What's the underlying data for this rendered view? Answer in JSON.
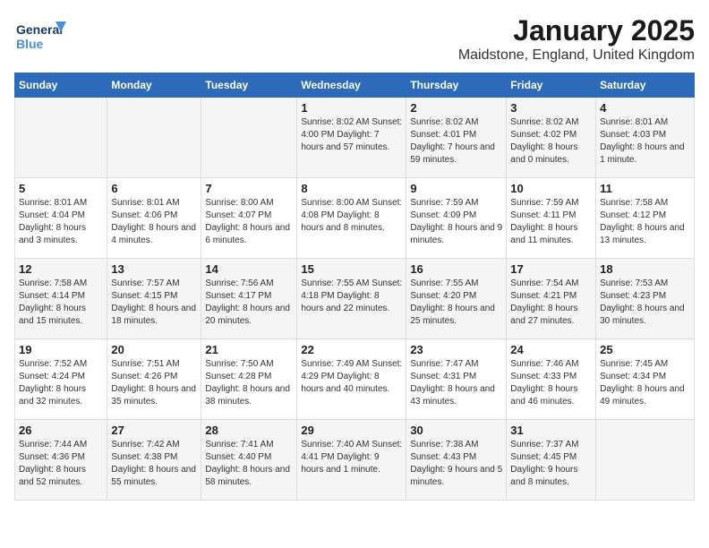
{
  "logo": {
    "line1": "General",
    "line2": "Blue"
  },
  "title": "January 2025",
  "subtitle": "Maidstone, England, United Kingdom",
  "weekdays": [
    "Sunday",
    "Monday",
    "Tuesday",
    "Wednesday",
    "Thursday",
    "Friday",
    "Saturday"
  ],
  "weeks": [
    [
      {
        "day": "",
        "content": ""
      },
      {
        "day": "",
        "content": ""
      },
      {
        "day": "",
        "content": ""
      },
      {
        "day": "1",
        "content": "Sunrise: 8:02 AM\nSunset: 4:00 PM\nDaylight: 7 hours and 57 minutes."
      },
      {
        "day": "2",
        "content": "Sunrise: 8:02 AM\nSunset: 4:01 PM\nDaylight: 7 hours and 59 minutes."
      },
      {
        "day": "3",
        "content": "Sunrise: 8:02 AM\nSunset: 4:02 PM\nDaylight: 8 hours and 0 minutes."
      },
      {
        "day": "4",
        "content": "Sunrise: 8:01 AM\nSunset: 4:03 PM\nDaylight: 8 hours and 1 minute."
      }
    ],
    [
      {
        "day": "5",
        "content": "Sunrise: 8:01 AM\nSunset: 4:04 PM\nDaylight: 8 hours and 3 minutes."
      },
      {
        "day": "6",
        "content": "Sunrise: 8:01 AM\nSunset: 4:06 PM\nDaylight: 8 hours and 4 minutes."
      },
      {
        "day": "7",
        "content": "Sunrise: 8:00 AM\nSunset: 4:07 PM\nDaylight: 8 hours and 6 minutes."
      },
      {
        "day": "8",
        "content": "Sunrise: 8:00 AM\nSunset: 4:08 PM\nDaylight: 8 hours and 8 minutes."
      },
      {
        "day": "9",
        "content": "Sunrise: 7:59 AM\nSunset: 4:09 PM\nDaylight: 8 hours and 9 minutes."
      },
      {
        "day": "10",
        "content": "Sunrise: 7:59 AM\nSunset: 4:11 PM\nDaylight: 8 hours and 11 minutes."
      },
      {
        "day": "11",
        "content": "Sunrise: 7:58 AM\nSunset: 4:12 PM\nDaylight: 8 hours and 13 minutes."
      }
    ],
    [
      {
        "day": "12",
        "content": "Sunrise: 7:58 AM\nSunset: 4:14 PM\nDaylight: 8 hours and 15 minutes."
      },
      {
        "day": "13",
        "content": "Sunrise: 7:57 AM\nSunset: 4:15 PM\nDaylight: 8 hours and 18 minutes."
      },
      {
        "day": "14",
        "content": "Sunrise: 7:56 AM\nSunset: 4:17 PM\nDaylight: 8 hours and 20 minutes."
      },
      {
        "day": "15",
        "content": "Sunrise: 7:55 AM\nSunset: 4:18 PM\nDaylight: 8 hours and 22 minutes."
      },
      {
        "day": "16",
        "content": "Sunrise: 7:55 AM\nSunset: 4:20 PM\nDaylight: 8 hours and 25 minutes."
      },
      {
        "day": "17",
        "content": "Sunrise: 7:54 AM\nSunset: 4:21 PM\nDaylight: 8 hours and 27 minutes."
      },
      {
        "day": "18",
        "content": "Sunrise: 7:53 AM\nSunset: 4:23 PM\nDaylight: 8 hours and 30 minutes."
      }
    ],
    [
      {
        "day": "19",
        "content": "Sunrise: 7:52 AM\nSunset: 4:24 PM\nDaylight: 8 hours and 32 minutes."
      },
      {
        "day": "20",
        "content": "Sunrise: 7:51 AM\nSunset: 4:26 PM\nDaylight: 8 hours and 35 minutes."
      },
      {
        "day": "21",
        "content": "Sunrise: 7:50 AM\nSunset: 4:28 PM\nDaylight: 8 hours and 38 minutes."
      },
      {
        "day": "22",
        "content": "Sunrise: 7:49 AM\nSunset: 4:29 PM\nDaylight: 8 hours and 40 minutes."
      },
      {
        "day": "23",
        "content": "Sunrise: 7:47 AM\nSunset: 4:31 PM\nDaylight: 8 hours and 43 minutes."
      },
      {
        "day": "24",
        "content": "Sunrise: 7:46 AM\nSunset: 4:33 PM\nDaylight: 8 hours and 46 minutes."
      },
      {
        "day": "25",
        "content": "Sunrise: 7:45 AM\nSunset: 4:34 PM\nDaylight: 8 hours and 49 minutes."
      }
    ],
    [
      {
        "day": "26",
        "content": "Sunrise: 7:44 AM\nSunset: 4:36 PM\nDaylight: 8 hours and 52 minutes."
      },
      {
        "day": "27",
        "content": "Sunrise: 7:42 AM\nSunset: 4:38 PM\nDaylight: 8 hours and 55 minutes."
      },
      {
        "day": "28",
        "content": "Sunrise: 7:41 AM\nSunset: 4:40 PM\nDaylight: 8 hours and 58 minutes."
      },
      {
        "day": "29",
        "content": "Sunrise: 7:40 AM\nSunset: 4:41 PM\nDaylight: 9 hours and 1 minute."
      },
      {
        "day": "30",
        "content": "Sunrise: 7:38 AM\nSunset: 4:43 PM\nDaylight: 9 hours and 5 minutes."
      },
      {
        "day": "31",
        "content": "Sunrise: 7:37 AM\nSunset: 4:45 PM\nDaylight: 9 hours and 8 minutes."
      },
      {
        "day": "",
        "content": ""
      }
    ]
  ]
}
